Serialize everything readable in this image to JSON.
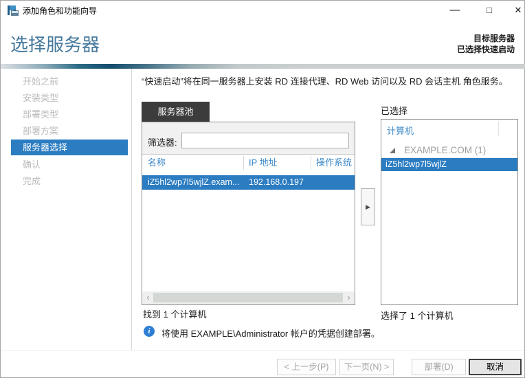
{
  "window": {
    "title": "添加角色和功能向导",
    "icons": {
      "minimize": "—",
      "maximize": "□",
      "close": "✕",
      "add_arrow": "▶",
      "scroll_left": "‹",
      "scroll_right": "›",
      "info": "i"
    }
  },
  "header": {
    "page_title": "选择服务器",
    "target_label": "目标服务器",
    "target_value": "已选择快速启动"
  },
  "sidebar": {
    "items": [
      {
        "label": "开始之前",
        "state": "disabled"
      },
      {
        "label": "安装类型",
        "state": "disabled"
      },
      {
        "label": "部署类型",
        "state": "disabled"
      },
      {
        "label": "部署方案",
        "state": "disabled"
      },
      {
        "label": "服务器选择",
        "state": "active"
      },
      {
        "label": "确认",
        "state": "disabled"
      },
      {
        "label": "完成",
        "state": "disabled"
      }
    ]
  },
  "main": {
    "description": "“快速启动”将在同一服务器上安装 RD 连接代理、RD Web 访问以及 RD 会话主机 角色服务。",
    "server_pool": {
      "tab_label": "服务器池",
      "filter_label": "筛选器:",
      "filter_value": "",
      "columns": [
        "名称",
        "IP 地址",
        "操作系统"
      ],
      "row": {
        "name": "iZ5hl2wp7l5wjlZ.exam...",
        "ip": "192.168.0.197"
      },
      "found_text": "找到 1 个计算机"
    },
    "selected_panel": {
      "title": "已选择",
      "column_header": "计算机",
      "group_label": "EXAMPLE.COM (1)",
      "item_label": "iZ5hl2wp7l5wjlZ",
      "count_text": "选择了 1 个计算机"
    },
    "info_message": "将使用 EXAMPLE\\Administrator 帐户的凭据创建部署。"
  },
  "footer": {
    "buttons": [
      {
        "label": "< 上一步(P)",
        "state": "disabled"
      },
      {
        "label": "下一页(N) >",
        "state": "disabled"
      },
      {
        "label": "部署(D)",
        "state": "disabled"
      },
      {
        "label": "取消",
        "state": "default"
      }
    ]
  },
  "colors": {
    "accent_selection": "#2b7cc1",
    "link_blue": "#3a87c8",
    "title_blue": "#45799c",
    "tab_dark": "#3c3c3c",
    "info_blue": "#2e7ed4"
  }
}
